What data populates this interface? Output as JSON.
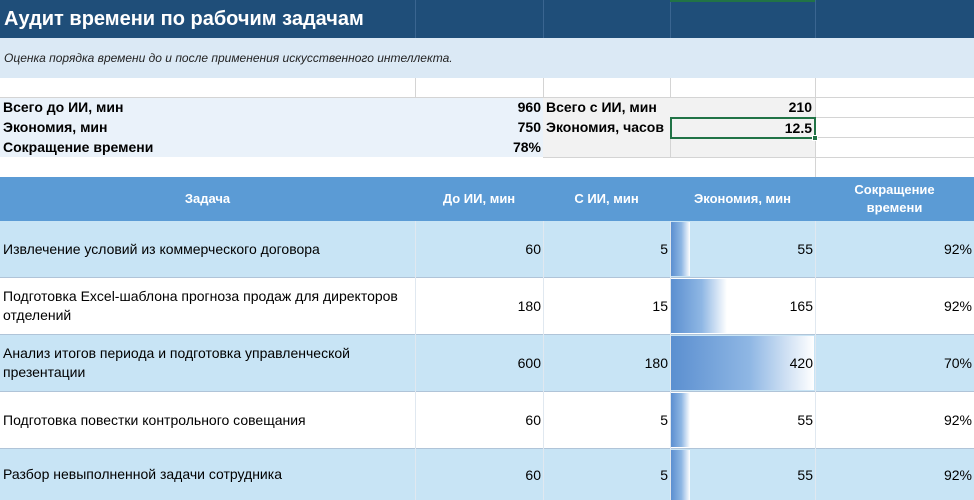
{
  "title": "Аудит времени по рабочим задачам",
  "subtitle": "Оценка порядка времени до и после применения искусственного интеллекта.",
  "summary": {
    "total_before_label": "Всего до ИИ, мин",
    "total_before_value": "960",
    "total_after_label": "Всего с ИИ, мин",
    "total_after_value": "210",
    "savings_min_label": "Экономия, мин",
    "savings_min_value": "750",
    "savings_hours_label": "Экономия, часов",
    "savings_hours_value": "12.5",
    "reduction_label": "Сокращение времени",
    "reduction_value": "78%"
  },
  "table": {
    "headers": {
      "task": "Задача",
      "before": "До ИИ, мин",
      "after": "С ИИ, мин",
      "savings": "Экономия, мин",
      "reduction_line1": "Сокращение",
      "reduction_line2": "времени"
    },
    "rows": [
      {
        "task": "Извлечение условий из коммерческого договора",
        "before": "60",
        "after": "5",
        "savings": "55",
        "reduction": "92%",
        "bar_fraction": 0.131
      },
      {
        "task": "Подготовка Excel-шаблона прогноза продаж для директоров отделений",
        "before": "180",
        "after": "15",
        "savings": "165",
        "reduction": "92%",
        "bar_fraction": 0.393
      },
      {
        "task": "Анализ итогов периода и подготовка управленческой презентации",
        "before": "600",
        "after": "180",
        "savings": "420",
        "reduction": "70%",
        "bar_fraction": 1.0
      },
      {
        "task": "Подготовка повестки контрольного совещания",
        "before": "60",
        "after": "5",
        "savings": "55",
        "reduction": "92%",
        "bar_fraction": 0.131
      },
      {
        "task": "Разбор невыполненной задачи сотрудника",
        "before": "60",
        "after": "5",
        "savings": "55",
        "reduction": "92%",
        "bar_fraction": 0.131
      }
    ]
  },
  "colors": {
    "title_bg": "#1f4e79",
    "subtitle_bg": "#dbe9f5",
    "header_bg": "#5b9bd5",
    "row_alt_bg": "#c8e4f5",
    "selection": "#217346"
  }
}
